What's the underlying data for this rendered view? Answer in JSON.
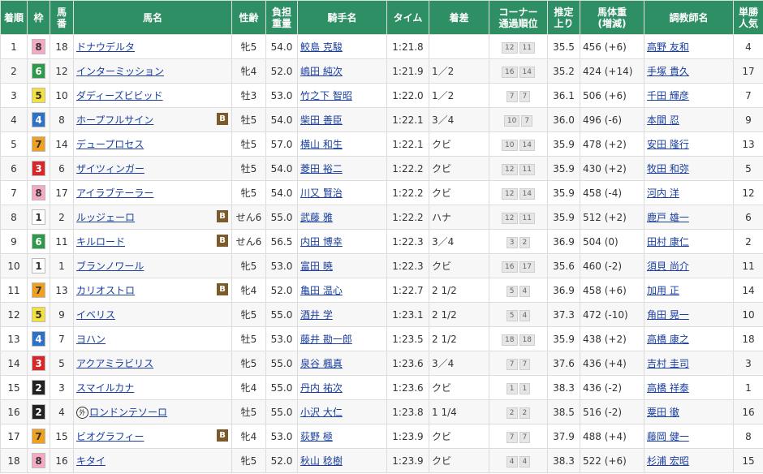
{
  "headers": [
    "着順",
    "枠",
    "馬番",
    "馬名",
    "性齢",
    "負担重量",
    "騎手名",
    "タイム",
    "着差",
    "コーナー通過順位",
    "推定上り",
    "馬体重(増減)",
    "調教師名",
    "単勝人気"
  ],
  "headers_display": {
    "chakujun": "着順",
    "waku": "枠",
    "umaban1": "馬",
    "umaban2": "番",
    "horse": "馬名",
    "sexage": "性齢",
    "weight1": "負担",
    "weight2": "重量",
    "jockey": "騎手名",
    "time": "タイム",
    "margin": "着差",
    "corner1": "コーナー",
    "corner2": "通過順位",
    "agari1": "推定",
    "agari2": "上り",
    "body1": "馬体重",
    "body2": "(増減)",
    "trainer": "調教師名",
    "pop1": "単勝",
    "pop2": "人気"
  },
  "waku_colors": {
    "1": {
      "bg": "#ffffff",
      "fg": "#333333"
    },
    "2": {
      "bg": "#222222",
      "fg": "#ffffff"
    },
    "3": {
      "bg": "#d9262b",
      "fg": "#ffffff"
    },
    "4": {
      "bg": "#2e72c7",
      "fg": "#ffffff"
    },
    "5": {
      "bg": "#f5e13d",
      "fg": "#333333"
    },
    "6": {
      "bg": "#2c9a48",
      "fg": "#ffffff"
    },
    "7": {
      "bg": "#f0a020",
      "fg": "#333333"
    },
    "8": {
      "bg": "#f6a9c4",
      "fg": "#333333"
    }
  },
  "blinker_label": "B",
  "gai_label": "外",
  "rows": [
    {
      "rank": "1",
      "waku": "8",
      "num": "18",
      "horse": "ドナウデルタ",
      "blinker": false,
      "gai": false,
      "sexage": "牝5",
      "weight": "54.0",
      "jockey": "鮫島 克駿",
      "time": "1:21.8",
      "margin": "",
      "corner": [
        "12",
        "11"
      ],
      "agari": "35.5",
      "body": "456 (+6)",
      "trainer": "高野 友和",
      "pop": "4"
    },
    {
      "rank": "2",
      "waku": "6",
      "num": "12",
      "horse": "インターミッション",
      "blinker": false,
      "gai": false,
      "sexage": "牝4",
      "weight": "52.0",
      "jockey": "嶋田 純次",
      "time": "1:21.9",
      "margin": "1／2",
      "corner": [
        "16",
        "14"
      ],
      "agari": "35.2",
      "body": "424 (+14)",
      "trainer": "手塚 貴久",
      "pop": "17"
    },
    {
      "rank": "3",
      "waku": "5",
      "num": "10",
      "horse": "ダディーズビビッド",
      "blinker": false,
      "gai": false,
      "sexage": "牡3",
      "weight": "53.0",
      "jockey": "竹之下 智昭",
      "time": "1:22.0",
      "margin": "1／2",
      "corner": [
        "7",
        "7"
      ],
      "agari": "36.1",
      "body": "506 (+6)",
      "trainer": "千田 輝彦",
      "pop": "7"
    },
    {
      "rank": "4",
      "waku": "4",
      "num": "8",
      "horse": "ホープフルサイン",
      "blinker": true,
      "gai": false,
      "sexage": "牡5",
      "weight": "54.0",
      "jockey": "柴田 善臣",
      "time": "1:22.1",
      "margin": "3／4",
      "corner": [
        "10",
        "7"
      ],
      "agari": "36.0",
      "body": "496 (-6)",
      "trainer": "本間 忍",
      "pop": "9"
    },
    {
      "rank": "5",
      "waku": "7",
      "num": "14",
      "horse": "デュープロセス",
      "blinker": false,
      "gai": false,
      "sexage": "牡5",
      "weight": "57.0",
      "jockey": "横山 和生",
      "time": "1:22.1",
      "margin": "クビ",
      "corner": [
        "10",
        "14"
      ],
      "agari": "35.9",
      "body": "478 (+2)",
      "trainer": "安田 隆行",
      "pop": "13"
    },
    {
      "rank": "6",
      "waku": "3",
      "num": "6",
      "horse": "ザイツィンガー",
      "blinker": false,
      "gai": false,
      "sexage": "牡5",
      "weight": "54.0",
      "jockey": "菱田 裕二",
      "time": "1:22.2",
      "margin": "クビ",
      "corner": [
        "12",
        "11"
      ],
      "agari": "35.9",
      "body": "430 (+2)",
      "trainer": "牧田 和弥",
      "pop": "5"
    },
    {
      "rank": "7",
      "waku": "8",
      "num": "17",
      "horse": "アイラブテーラー",
      "blinker": false,
      "gai": false,
      "sexage": "牝5",
      "weight": "54.0",
      "jockey": "川又 賢治",
      "time": "1:22.2",
      "margin": "クビ",
      "corner": [
        "12",
        "14"
      ],
      "agari": "35.9",
      "body": "458 (-4)",
      "trainer": "河内 洋",
      "pop": "12"
    },
    {
      "rank": "8",
      "waku": "1",
      "num": "2",
      "horse": "ルッジェーロ",
      "blinker": true,
      "gai": false,
      "sexage": "せん6",
      "weight": "55.0",
      "jockey": "武藤 雅",
      "time": "1:22.2",
      "margin": "ハナ",
      "corner": [
        "12",
        "11"
      ],
      "agari": "35.9",
      "body": "512 (+2)",
      "trainer": "鹿戸 雄一",
      "pop": "6"
    },
    {
      "rank": "9",
      "waku": "6",
      "num": "11",
      "horse": "キルロード",
      "blinker": true,
      "gai": false,
      "sexage": "せん6",
      "weight": "56.5",
      "jockey": "内田 博幸",
      "time": "1:22.3",
      "margin": "3／4",
      "corner": [
        "3",
        "2"
      ],
      "agari": "36.9",
      "body": "504 (0)",
      "trainer": "田村 康仁",
      "pop": "2"
    },
    {
      "rank": "10",
      "waku": "1",
      "num": "1",
      "horse": "ブランノワール",
      "blinker": false,
      "gai": false,
      "sexage": "牝5",
      "weight": "53.0",
      "jockey": "富田 暁",
      "time": "1:22.3",
      "margin": "クビ",
      "corner": [
        "16",
        "17"
      ],
      "agari": "35.6",
      "body": "460 (-2)",
      "trainer": "須貝 尚介",
      "pop": "11"
    },
    {
      "rank": "11",
      "waku": "7",
      "num": "13",
      "horse": "カリオストロ",
      "blinker": true,
      "gai": false,
      "sexage": "牝4",
      "weight": "52.0",
      "jockey": "亀田 温心",
      "time": "1:22.7",
      "margin": "2 1/2",
      "corner": [
        "5",
        "4"
      ],
      "agari": "36.9",
      "body": "458 (+6)",
      "trainer": "加用 正",
      "pop": "14"
    },
    {
      "rank": "12",
      "waku": "5",
      "num": "9",
      "horse": "イベリス",
      "blinker": false,
      "gai": false,
      "sexage": "牝5",
      "weight": "55.0",
      "jockey": "酒井 学",
      "time": "1:23.1",
      "margin": "2 1/2",
      "corner": [
        "5",
        "4"
      ],
      "agari": "37.3",
      "body": "472 (-10)",
      "trainer": "角田 晃一",
      "pop": "10"
    },
    {
      "rank": "13",
      "waku": "4",
      "num": "7",
      "horse": "ヨハン",
      "blinker": false,
      "gai": false,
      "sexage": "牡5",
      "weight": "53.0",
      "jockey": "藤井 勘一郎",
      "time": "1:23.5",
      "margin": "2 1/2",
      "corner": [
        "18",
        "18"
      ],
      "agari": "35.9",
      "body": "438 (+2)",
      "trainer": "高橋 康之",
      "pop": "18"
    },
    {
      "rank": "14",
      "waku": "3",
      "num": "5",
      "horse": "アクアミラビリス",
      "blinker": false,
      "gai": false,
      "sexage": "牝5",
      "weight": "55.0",
      "jockey": "泉谷 楓真",
      "time": "1:23.6",
      "margin": "3／4",
      "corner": [
        "7",
        "7"
      ],
      "agari": "37.6",
      "body": "436 (+4)",
      "trainer": "吉村 圭司",
      "pop": "3"
    },
    {
      "rank": "15",
      "waku": "2",
      "num": "3",
      "horse": "スマイルカナ",
      "blinker": false,
      "gai": false,
      "sexage": "牝4",
      "weight": "55.0",
      "jockey": "丹内 祐次",
      "time": "1:23.6",
      "margin": "クビ",
      "corner": [
        "1",
        "1"
      ],
      "agari": "38.3",
      "body": "436 (-2)",
      "trainer": "高橋 祥泰",
      "pop": "1"
    },
    {
      "rank": "16",
      "waku": "2",
      "num": "4",
      "horse": "ロンドンテソーロ",
      "blinker": false,
      "gai": true,
      "sexage": "牡5",
      "weight": "55.0",
      "jockey": "小沢 大仁",
      "time": "1:23.8",
      "margin": "1 1/4",
      "corner": [
        "2",
        "2"
      ],
      "agari": "38.5",
      "body": "516 (-2)",
      "trainer": "粟田 徹",
      "pop": "16"
    },
    {
      "rank": "17",
      "waku": "7",
      "num": "15",
      "horse": "ビオグラフィー",
      "blinker": true,
      "gai": false,
      "sexage": "牝4",
      "weight": "53.0",
      "jockey": "荻野 極",
      "time": "1:23.9",
      "margin": "クビ",
      "corner": [
        "7",
        "7"
      ],
      "agari": "37.9",
      "body": "488 (+4)",
      "trainer": "藤岡 健一",
      "pop": "8"
    },
    {
      "rank": "18",
      "waku": "8",
      "num": "16",
      "horse": "キタイ",
      "blinker": false,
      "gai": false,
      "sexage": "牝5",
      "weight": "52.0",
      "jockey": "秋山 稔樹",
      "time": "1:23.9",
      "margin": "クビ",
      "corner": [
        "4",
        "4"
      ],
      "agari": "38.3",
      "body": "522 (+6)",
      "trainer": "杉浦 宏昭",
      "pop": "15"
    }
  ]
}
